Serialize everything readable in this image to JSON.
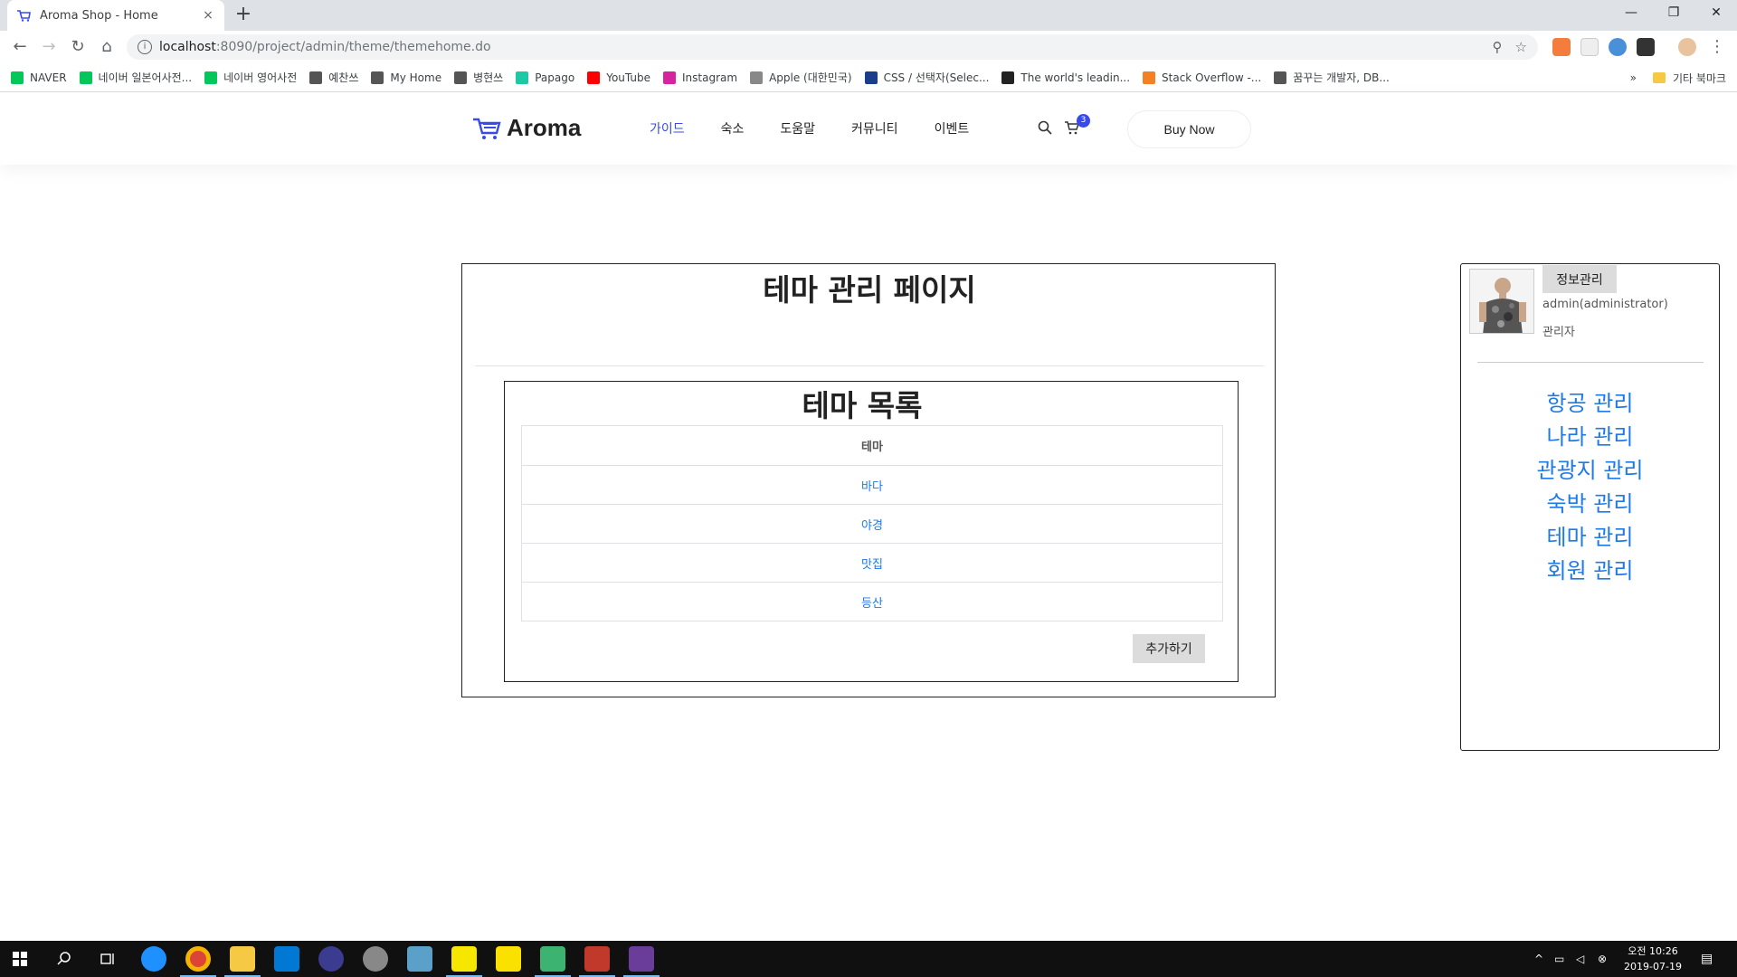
{
  "browser": {
    "tab_title": "Aroma Shop - Home",
    "tab_close": "×",
    "new_tab": "+",
    "url_host": "localhost",
    "url_path": ":8090/project/admin/theme/themehome.do",
    "bookmarks": [
      {
        "label": "NAVER",
        "color": "#03c75a"
      },
      {
        "label": "네이버 일본어사전...",
        "color": "#03c75a"
      },
      {
        "label": "네이버 영어사전",
        "color": "#03c75a"
      },
      {
        "label": "예찬쓰",
        "color": "#555555"
      },
      {
        "label": "My Home",
        "color": "#555555"
      },
      {
        "label": "병현쓰",
        "color": "#555555"
      },
      {
        "label": "Papago",
        "color": "#1ec8a5"
      },
      {
        "label": "YouTube",
        "color": "#ff0000"
      },
      {
        "label": "Instagram",
        "color": "#d6249f"
      },
      {
        "label": "Apple (대한민국)",
        "color": "#888888"
      },
      {
        "label": "CSS / 선택자(Selec...",
        "color": "#1a3e8c"
      },
      {
        "label": "The world's leadin...",
        "color": "#222222"
      },
      {
        "label": "Stack Overflow -...",
        "color": "#f48024"
      },
      {
        "label": "꿈꾸는 개발자, DB...",
        "color": "#555555"
      }
    ],
    "bookmarks_more": "»",
    "other_bookmarks": "기타 북마크"
  },
  "header": {
    "logo": "Aroma",
    "menu": [
      "가이드",
      "숙소",
      "도움말",
      "커뮤니티",
      "이벤트"
    ],
    "active_menu_index": 0,
    "cart_count": "3",
    "buy_now": "Buy Now",
    "accent_color": "#384aeb"
  },
  "main": {
    "page_title": "테마 관리 페이지",
    "list_title": "테마 목록",
    "table_header": "테마",
    "themes": [
      "바다",
      "야경",
      "맛집",
      "등산"
    ],
    "add_button": "추가하기"
  },
  "sidebar": {
    "info_button": "정보관리",
    "user_name": "admin(administrator)",
    "user_role": "관리자",
    "menu": [
      "항공 관리",
      "나라 관리",
      "관광지 관리",
      "숙박 관리",
      "테마 관리",
      "회원 관리"
    ],
    "link_color": "#1e7ae5"
  },
  "taskbar": {
    "clock_line1": "오전 10:26",
    "clock_line2": "2019-07-19"
  }
}
